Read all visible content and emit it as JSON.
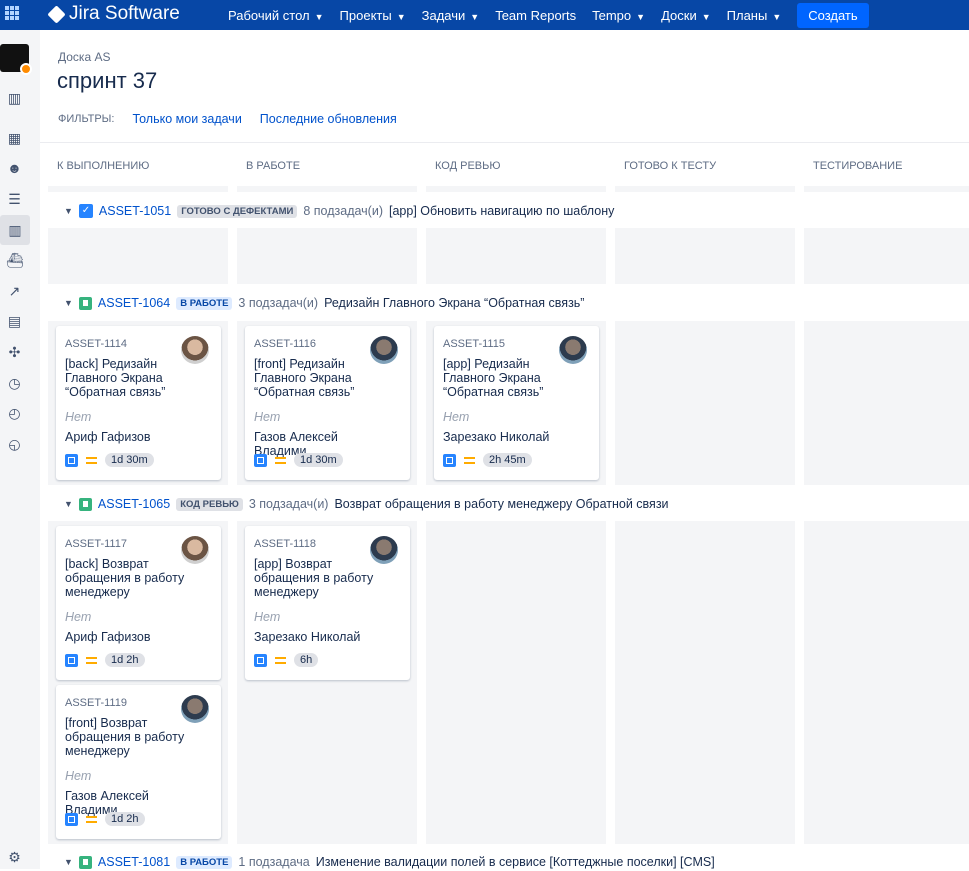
{
  "nav": {
    "app": "Jira Software",
    "items": [
      "Рабочий стол",
      "Проекты",
      "Задачи",
      "Team Reports",
      "Tempo",
      "Доски",
      "Планы"
    ],
    "dropdowns": [
      true,
      true,
      true,
      false,
      true,
      true,
      true
    ],
    "create": "Создать"
  },
  "breadcrumb": "Доска AS",
  "title": "спринт 37",
  "filters": {
    "label": "ФИЛЬТРЫ:",
    "items": [
      "Только мои задачи",
      "Последние обновления"
    ]
  },
  "columns": [
    "К ВЫПОЛНЕНИЮ",
    "В РАБОТЕ",
    "КОД РЕВЬЮ",
    "ГОТОВО К ТЕСТУ",
    "ТЕСТИРОВАНИЕ"
  ],
  "lanes": [
    {
      "key": "ASSET-1051",
      "status": "ГОТОВО С ДЕФЕКТАМИ",
      "subtasks": "8 подзадач(и)",
      "summary": "[app] Обновить навигацию по шаблону"
    },
    {
      "key": "ASSET-1064",
      "status": "В РАБОТЕ",
      "subtasks": "3 подзадач(и)",
      "summary": "Редизайн Главного Экрана “Обратная связь”"
    },
    {
      "key": "ASSET-1065",
      "status": "КОД РЕВЬЮ",
      "subtasks": "3 подзадач(и)",
      "summary": "Возврат обращения в работу менеджеру Обратной связи"
    },
    {
      "key": "ASSET-1081",
      "status": "В РАБОТЕ",
      "subtasks": "1 подзадача",
      "summary": "Изменение валидации полей в сервисе [Коттеджные поселки] [CMS]"
    }
  ],
  "cards": [
    {
      "key": "ASSET-1114",
      "summary": "[back] Редизайн Главного Экрана “Обратная связь”",
      "field": "Нет",
      "assignee": "Ариф Гафизов",
      "estimate": "1d 30m"
    },
    {
      "key": "ASSET-1116",
      "summary": "[front] Редизайн Главного Экрана “Обратная связь”",
      "field": "Нет",
      "assignee": "Газов Алексей Владими...",
      "estimate": "1d 30m"
    },
    {
      "key": "ASSET-1115",
      "summary": "[app] Редизайн Главного Экрана “Обратная связь”",
      "field": "Нет",
      "assignee": "Зарезако Николай",
      "estimate": "2h 45m"
    },
    {
      "key": "ASSET-1117",
      "summary": "[back] Возврат обращения в работу менеджеру",
      "field": "Нет",
      "assignee": "Ариф Гафизов",
      "estimate": "1d 2h"
    },
    {
      "key": "ASSET-1118",
      "summary": "[app] Возврат обращения в работу менеджеру",
      "field": "Нет",
      "assignee": "Зарезако Николай",
      "estimate": "6h"
    },
    {
      "key": "ASSET-1119",
      "summary": "[front] Возврат обращения в работу менеджеру",
      "field": "Нет",
      "assignee": "Газов Алексей Владими...",
      "estimate": "1d 2h"
    }
  ]
}
